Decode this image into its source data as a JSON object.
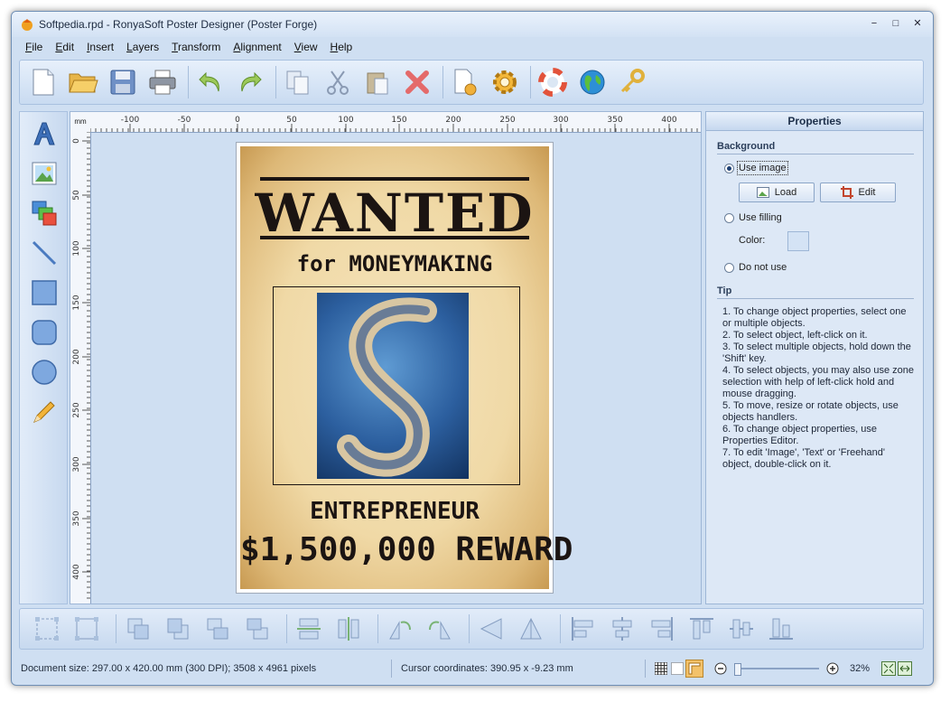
{
  "window": {
    "title": "Softpedia.rpd - RonyaSoft Poster Designer (Poster Forge)",
    "controls": {
      "minimize": "−",
      "maximize": "□",
      "close": "✕"
    }
  },
  "menu": [
    {
      "accel": "F",
      "rest": "ile"
    },
    {
      "accel": "E",
      "rest": "dit"
    },
    {
      "accel": "I",
      "rest": "nsert"
    },
    {
      "accel": "L",
      "rest": "ayers"
    },
    {
      "accel": "T",
      "rest": "ransform"
    },
    {
      "accel": "A",
      "rest": "lignment"
    },
    {
      "accel": "V",
      "rest": "iew"
    },
    {
      "accel": "H",
      "rest": "elp"
    }
  ],
  "toolbar": {
    "icons": [
      "new-document-icon",
      "open-folder-icon",
      "save-icon",
      "print-icon",
      "undo-icon",
      "redo-icon",
      "copy-icon",
      "cut-icon",
      "paste-icon",
      "delete-icon",
      "page-setup-icon",
      "settings-icon",
      "help-lifebuoy-icon",
      "website-globe-icon",
      "register-key-icon"
    ]
  },
  "tools": [
    "text-tool-icon",
    "image-tool-icon",
    "layers-tool-icon",
    "line-tool-icon",
    "rectangle-tool-icon",
    "rounded-rectangle-tool-icon",
    "ellipse-tool-icon",
    "freehand-pencil-icon"
  ],
  "ruler": {
    "unit": "mm",
    "h_labels": [
      "-100",
      "-50",
      "0",
      "50",
      "100",
      "150",
      "200",
      "250",
      "300",
      "350",
      "400"
    ],
    "v_labels": [
      "0",
      "50",
      "100",
      "150",
      "200",
      "250",
      "300",
      "350",
      "400"
    ]
  },
  "poster": {
    "headline": "WANTED",
    "subtitle": "for MONEYMAKING",
    "occupation": "ENTREPRENEUR",
    "reward": "$1,500,000 REWARD"
  },
  "properties": {
    "header": "Properties",
    "background": {
      "title": "Background",
      "use_image": "Use image",
      "load": "Load",
      "edit": "Edit",
      "use_filling": "Use filling",
      "color_label": "Color:",
      "do_not_use": "Do not use",
      "selected": "use_image"
    },
    "tip": {
      "title": "Tip",
      "items": [
        "1. To change object properties, select one or multiple objects.",
        "2. To select object, left-click on it.",
        "3. To select multiple objects, hold down the 'Shift' key.",
        "4. To select objects, you may also use zone selection with help of left-click hold and mouse dragging.",
        "5. To move, resize or rotate objects, use objects handlers.",
        "6. To change object properties, use Properties Editor.",
        "7. To edit 'Image', 'Text' or 'Freehand' object, double-click on it."
      ]
    }
  },
  "bottom_toolbar": {
    "icons": [
      "group-icon",
      "ungroup-icon",
      "bring-to-front-icon",
      "send-to-back-icon",
      "bring-forward-icon",
      "send-backward-icon",
      "same-width-icon",
      "same-height-icon",
      "rotate-left-icon",
      "rotate-right-icon",
      "flip-horizontal-icon",
      "flip-vertical-icon",
      "align-left-icon",
      "align-center-icon",
      "align-right-icon",
      "align-top-icon",
      "align-middle-icon",
      "align-bottom-icon"
    ]
  },
  "status": {
    "document_size": "Document size: 297.00 x 420.00 mm (300 DPI); 3508 x 4961 pixels",
    "cursor": "Cursor coordinates: 390.95 x -9.23 mm",
    "zoom": "32%"
  }
}
